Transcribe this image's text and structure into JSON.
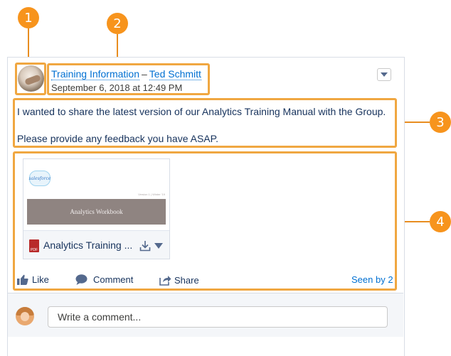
{
  "callouts": [
    "1",
    "2",
    "3",
    "4"
  ],
  "post": {
    "group_link": "Training Information",
    "separator": "–",
    "author_link": "Ted Schmitt",
    "date": "September 6, 2018 at 12:49 PM",
    "body_line1": "I wanted to share the latest version of our Analytics Training Manual with the Group.",
    "body_line2": "Please provide any feedback you have ASAP."
  },
  "attachment": {
    "logo_text": "salesforce",
    "cover_title": "Analytics Workbook",
    "cover_subtitle": "Version 1 | Winter '19",
    "file_type": "PDF",
    "file_name": "Analytics Training ..."
  },
  "actions": {
    "like": "Like",
    "comment": "Comment",
    "share": "Share",
    "seen_by": "Seen by 2"
  },
  "comment": {
    "placeholder": "Write a comment..."
  },
  "colors": {
    "callout": "#f7941d",
    "highlight": "#f0a741",
    "link": "#0070d2"
  }
}
